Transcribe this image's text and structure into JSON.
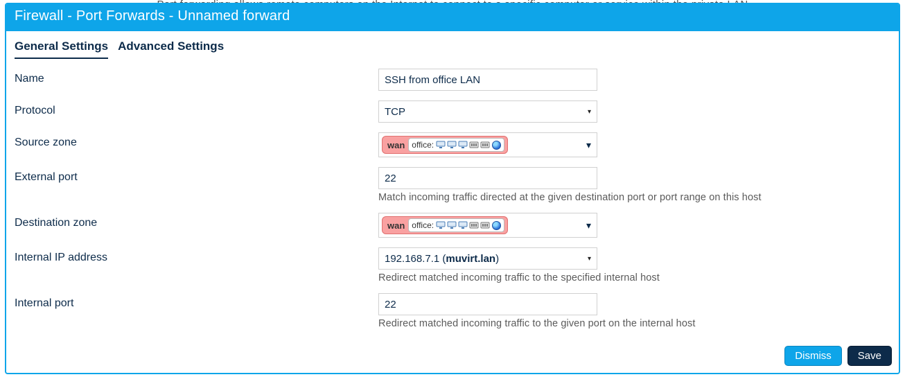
{
  "backdrop_hint": "Port forwarding allows remote computers on the Internet to connect to a specific computer or service within the private LAN",
  "header": {
    "title": "Firewall - Port Forwards - Unnamed forward"
  },
  "tabs": {
    "general": "General Settings",
    "advanced": "Advanced Settings"
  },
  "labels": {
    "name": "Name",
    "protocol": "Protocol",
    "source_zone": "Source zone",
    "external_port": "External port",
    "destination_zone": "Destination zone",
    "internal_ip": "Internal IP address",
    "internal_port": "Internal port"
  },
  "fields": {
    "name": "SSH from office LAN",
    "protocol": "TCP",
    "zone_name": "wan",
    "zone_sub_label": "office:",
    "external_port": "22",
    "internal_ip_prefix": "192.168.7.1 (",
    "internal_ip_host": "muvirt.lan",
    "internal_ip_suffix": ")",
    "internal_port": "22"
  },
  "help": {
    "external_port": "Match incoming traffic directed at the given destination port or port range on this host",
    "internal_ip": "Redirect matched incoming traffic to the specified internal host",
    "internal_port": "Redirect matched incoming traffic to the given port on the internal host"
  },
  "footer": {
    "dismiss": "Dismiss",
    "save": "Save"
  }
}
